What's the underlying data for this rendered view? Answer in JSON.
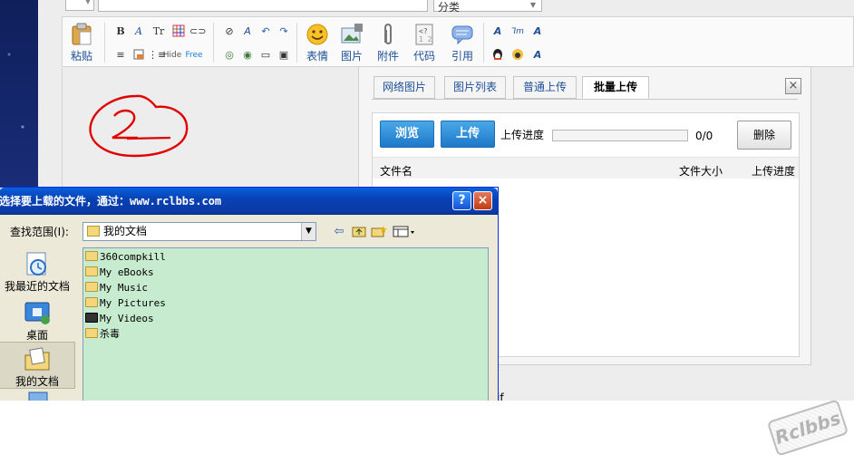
{
  "editor": {
    "category_label": "分类",
    "toolbar": {
      "paste": "粘贴",
      "hide": "Hide",
      "free": "Free",
      "emoticon": "表情",
      "image": "图片",
      "attachment": "附件",
      "code": "代码",
      "quote": "引用"
    }
  },
  "upload_panel": {
    "tabs": [
      "网络图片",
      "图片列表",
      "普通上传",
      "批量上传"
    ],
    "active_tab": 3,
    "close": "×",
    "browse": "浏览",
    "upload": "上传",
    "progress_label": "上传进度",
    "progress_fraction": 0,
    "progress_count": "0/0",
    "delete": "删除",
    "columns": {
      "name": "文件名",
      "size": "文件大小",
      "progress": "上传进度"
    }
  },
  "annotation": {
    "text": "2",
    "color": "#e00000"
  },
  "file_dialog": {
    "title": "选择要上载的文件，通过：www.rclbbs.com",
    "help": "?",
    "close": "×",
    "lookin_label": "查找范围(I):",
    "lookin_value": "我的文档",
    "places": [
      {
        "label": "我最近的文档",
        "icon": "recent-documents-icon"
      },
      {
        "label": "桌面",
        "icon": "desktop-icon"
      },
      {
        "label": "我的文档",
        "icon": "my-documents-icon",
        "selected": true
      },
      {
        "label": "",
        "icon": "my-computer-icon"
      }
    ],
    "files": [
      {
        "name": "360compkill",
        "icon": "folder-icon"
      },
      {
        "name": "My eBooks",
        "icon": "folder-icon"
      },
      {
        "name": "My Music",
        "icon": "music-folder-icon"
      },
      {
        "name": "My Pictures",
        "icon": "pictures-folder-icon"
      },
      {
        "name": "My Videos",
        "icon": "videos-folder-icon"
      },
      {
        "name": "杀毒",
        "icon": "folder-icon"
      }
    ],
    "list_bg": "#c7ebce"
  },
  "behind_text": "if",
  "watermark": "Rclbbs"
}
